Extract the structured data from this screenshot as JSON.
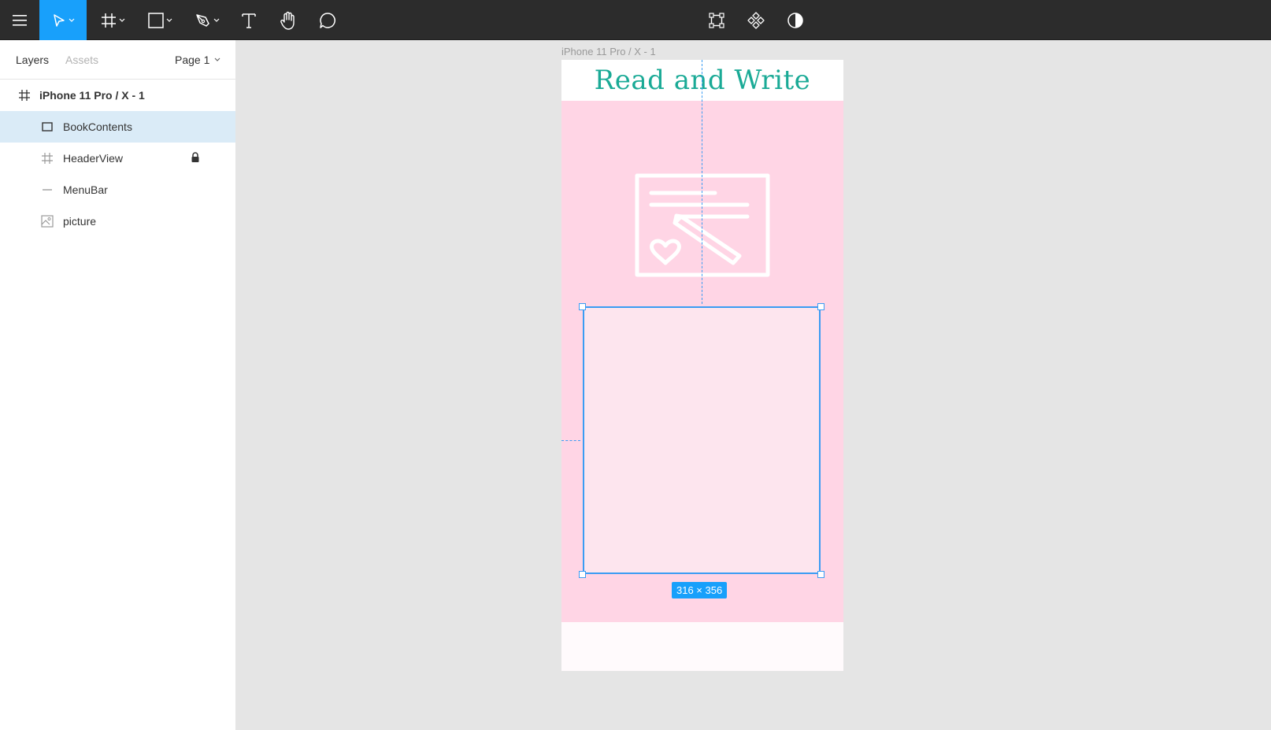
{
  "toolbar": {
    "tools": [
      "main-menu",
      "move",
      "frame",
      "shape",
      "pen",
      "text",
      "hand",
      "comment"
    ],
    "center_tools": [
      "edit-object",
      "create-component",
      "mask"
    ],
    "accent_color": "#18a0fb"
  },
  "panel": {
    "tabs": {
      "layers": "Layers",
      "assets": "Assets"
    },
    "page": "Page 1",
    "layers": [
      {
        "label": "iPhone 11 Pro / X - 1",
        "icon": "frame-icon",
        "selected": false,
        "locked": false
      },
      {
        "label": "BookContents",
        "icon": "rectangle-icon",
        "selected": true,
        "locked": false
      },
      {
        "label": "HeaderView",
        "icon": "frame-icon",
        "selected": false,
        "locked": true
      },
      {
        "label": "MenuBar",
        "icon": "line-icon",
        "selected": false,
        "locked": false
      },
      {
        "label": "picture",
        "icon": "image-icon",
        "selected": false,
        "locked": false
      }
    ]
  },
  "canvas": {
    "frame_label": "iPhone 11 Pro / X - 1",
    "app_title": "Read and Write",
    "selection_size": "316 × 356",
    "colors": {
      "title": "#1aaa96",
      "body": "#ffd5e5",
      "selection": "#3b9cf3"
    }
  }
}
